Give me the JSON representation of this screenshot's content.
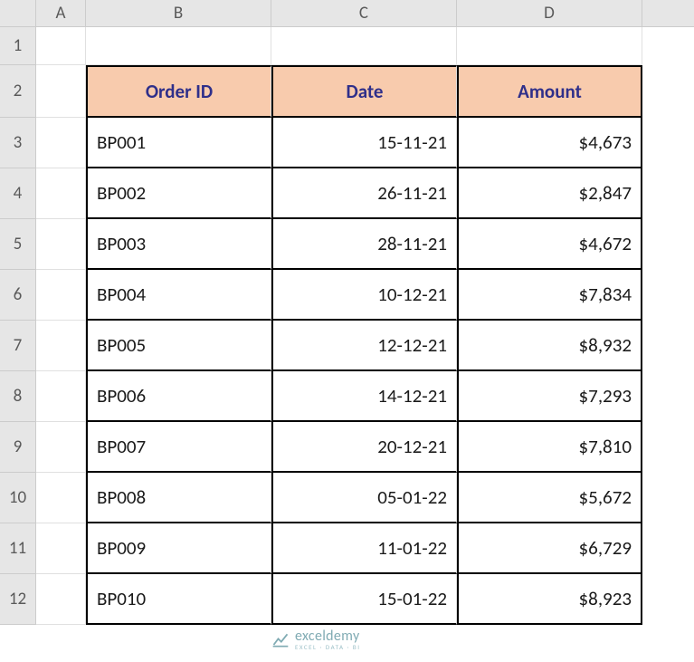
{
  "columns": [
    "A",
    "B",
    "C",
    "D"
  ],
  "row_labels": [
    "1",
    "2",
    "3",
    "4",
    "5",
    "6",
    "7",
    "8",
    "9",
    "10",
    "11",
    "12"
  ],
  "headers": {
    "order_id": "Order ID",
    "date": "Date",
    "amount": "Amount"
  },
  "table": [
    {
      "order_id": "BP001",
      "date": "15-11-21",
      "amount": "$4,673"
    },
    {
      "order_id": "BP002",
      "date": "26-11-21",
      "amount": "$2,847"
    },
    {
      "order_id": "BP003",
      "date": "28-11-21",
      "amount": "$4,672"
    },
    {
      "order_id": "BP004",
      "date": "10-12-21",
      "amount": "$7,834"
    },
    {
      "order_id": "BP005",
      "date": "12-12-21",
      "amount": "$8,932"
    },
    {
      "order_id": "BP006",
      "date": "14-12-21",
      "amount": "$7,293"
    },
    {
      "order_id": "BP007",
      "date": "20-12-21",
      "amount": "$7,810"
    },
    {
      "order_id": "BP008",
      "date": "05-01-22",
      "amount": "$5,672"
    },
    {
      "order_id": "BP009",
      "date": "11-01-22",
      "amount": "$6,729"
    },
    {
      "order_id": "BP010",
      "date": "15-01-22",
      "amount": "$8,923"
    }
  ],
  "watermark": {
    "main": "exceldemy",
    "sub": "EXCEL · DATA · BI"
  },
  "chart_data": {
    "type": "table",
    "title": "",
    "columns": [
      "Order ID",
      "Date",
      "Amount"
    ],
    "rows": [
      [
        "BP001",
        "15-11-21",
        4673
      ],
      [
        "BP002",
        "26-11-21",
        2847
      ],
      [
        "BP003",
        "28-11-21",
        4672
      ],
      [
        "BP004",
        "10-12-21",
        7834
      ],
      [
        "BP005",
        "12-12-21",
        8932
      ],
      [
        "BP006",
        "14-12-21",
        7293
      ],
      [
        "BP007",
        "20-12-21",
        7810
      ],
      [
        "BP008",
        "05-01-22",
        5672
      ],
      [
        "BP009",
        "11-01-22",
        6729
      ],
      [
        "BP010",
        "15-01-22",
        8923
      ]
    ],
    "currency": "USD"
  }
}
